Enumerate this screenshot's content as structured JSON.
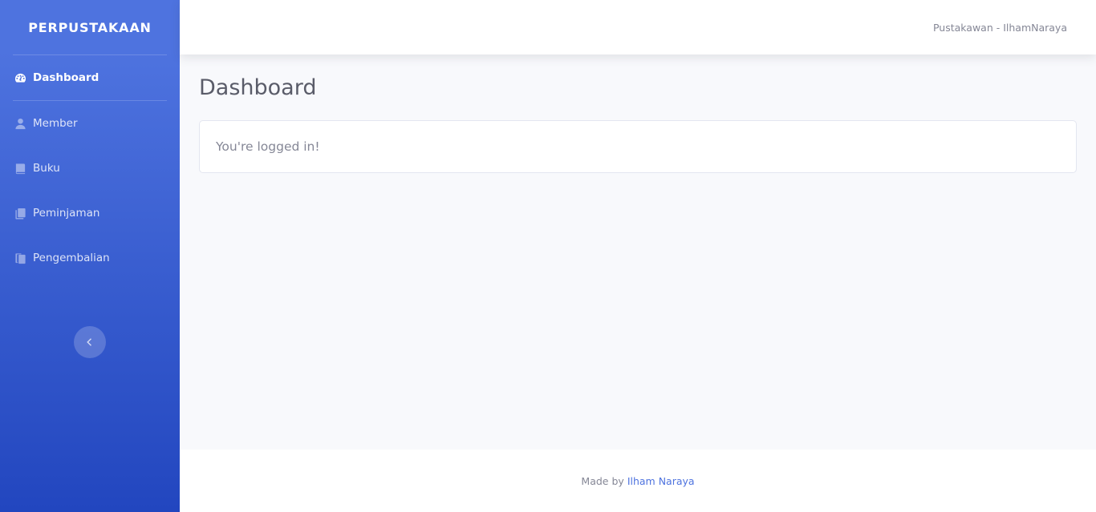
{
  "sidebar": {
    "brand": "PERPUSTAKAAN",
    "items": [
      {
        "label": "Dashboard",
        "icon": "tachometer-icon",
        "active": true
      },
      {
        "label": "Member",
        "icon": "user-icon",
        "active": false
      },
      {
        "label": "Buku",
        "icon": "book-icon",
        "active": false
      },
      {
        "label": "Peminjaman",
        "icon": "copy-icon",
        "active": false
      },
      {
        "label": "Pengembalian",
        "icon": "copy-icon",
        "active": false
      }
    ],
    "toggle_icon": "chevron-left-icon"
  },
  "topbar": {
    "user": "Pustakawan - IlhamNaraya"
  },
  "main": {
    "title": "Dashboard",
    "card_text": "You're logged in!"
  },
  "footer": {
    "prefix": "Made by",
    "author": "Ilham Naraya"
  },
  "colors": {
    "primary": "#4e73df",
    "sidebar_bottom": "#2246bf",
    "text_muted": "#858796",
    "title": "#5a5c69",
    "background": "#f8f9fc"
  }
}
